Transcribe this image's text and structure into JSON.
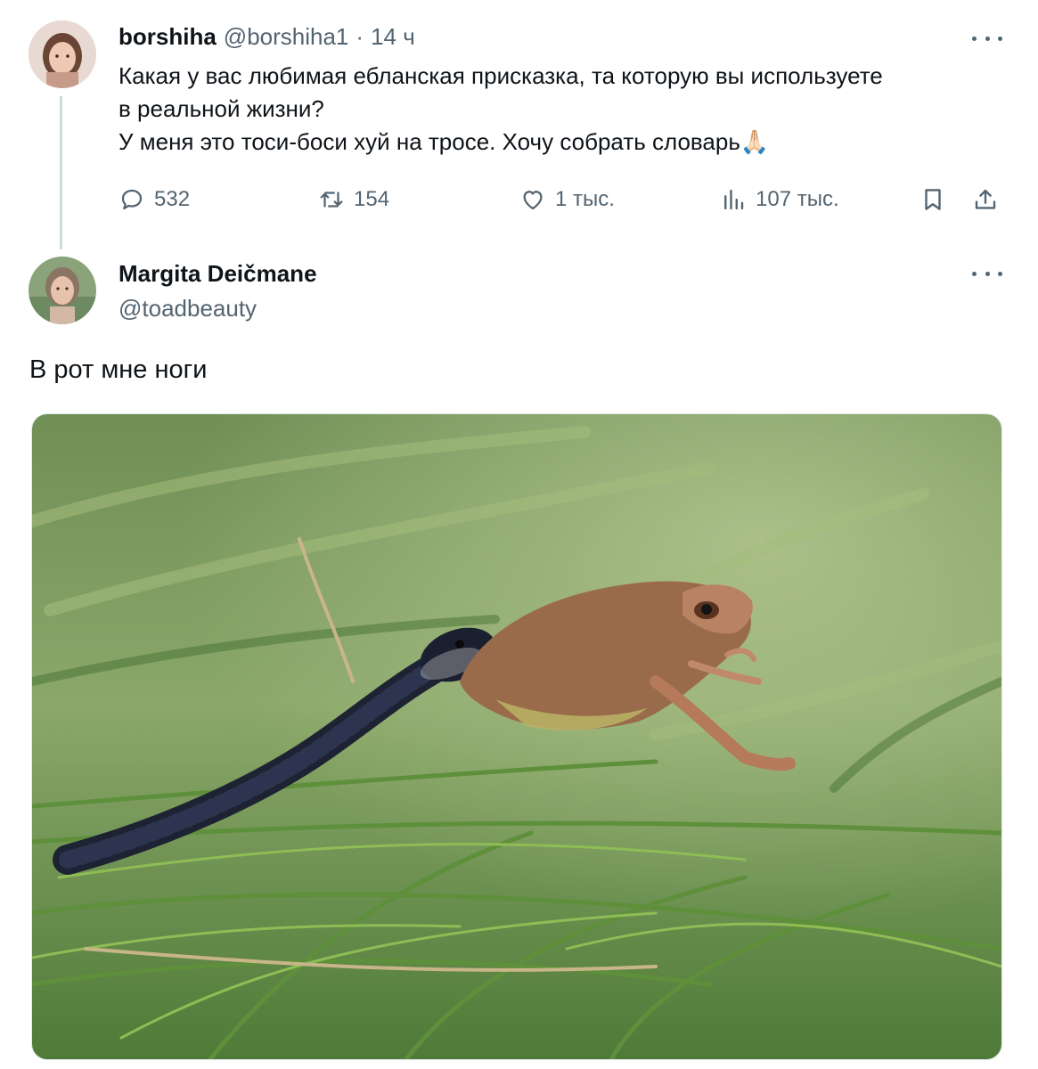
{
  "tweet1": {
    "author_name": "borshiha",
    "author_handle": "@borshiha1",
    "separator": "·",
    "time": "14 ч",
    "lines": [
      "Какая у вас любимая ебланская присказка, та которую вы используете",
      "в реальной жизни?",
      "У меня это тоси-боси хуй на тросе. Хочу собрать словарь"
    ],
    "emoji": "🙏🏻",
    "actions": {
      "replies": "532",
      "retweets": "154",
      "likes": "1 тыс.",
      "views": "107 тыс."
    }
  },
  "tweet2": {
    "author_name": "Margita Deičmane",
    "author_handle": "@toadbeauty",
    "text": "В рот мне ноги",
    "photo_alt": "snake-eating-frog-photo"
  },
  "colors": {
    "text_primary": "#0f1419",
    "text_secondary": "#536471",
    "thread_line": "#cfd9de"
  }
}
